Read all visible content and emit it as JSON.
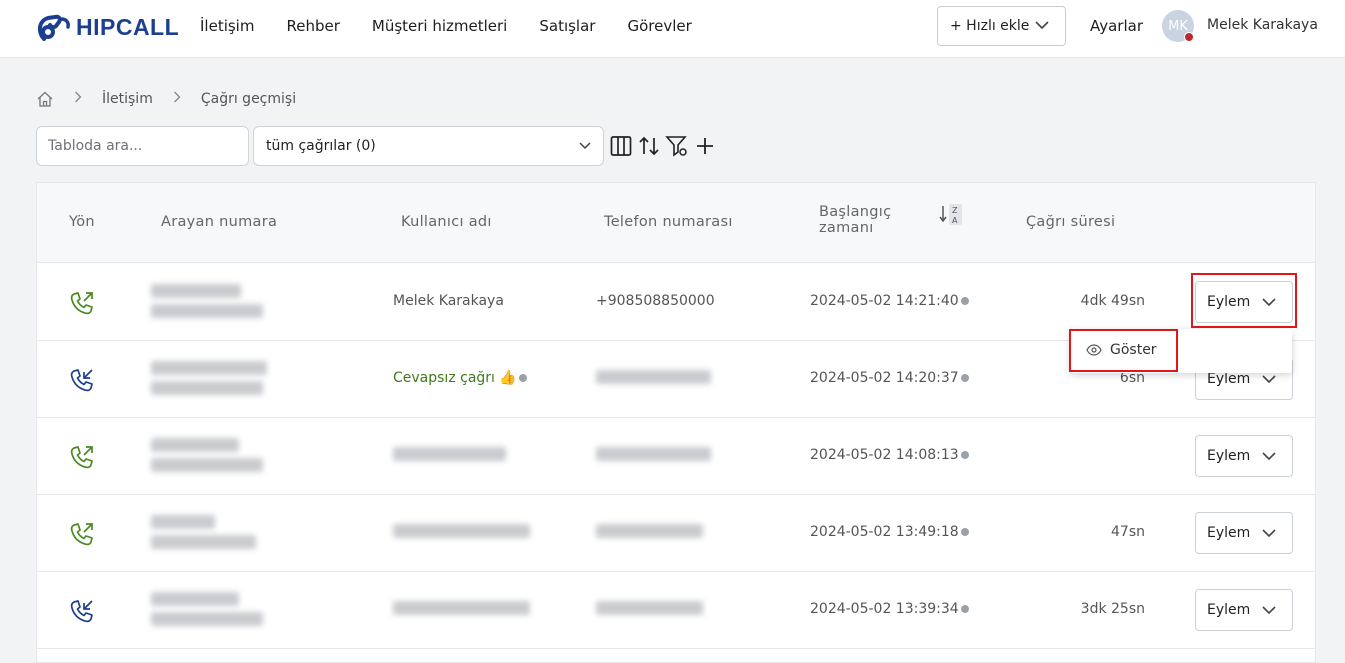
{
  "brand": {
    "name": "HIPCALL",
    "color": "#1d3f8f"
  },
  "nav": {
    "items": [
      "İletişim",
      "Rehber",
      "Müşteri hizmetleri",
      "Satışlar",
      "Görevler"
    ]
  },
  "header": {
    "quick_add": "+ Hızlı ekle",
    "settings": "Ayarlar",
    "avatar_initials": "MK",
    "username": "Melek Karakaya"
  },
  "breadcrumb": {
    "home_icon": "home-icon",
    "items": [
      "İletişim",
      "Çağrı geçmişi"
    ]
  },
  "toolbar": {
    "search_placeholder": "Tabloda ara...",
    "filter_value": "tüm çağrılar (0)",
    "icons": [
      "columns-icon",
      "sort-icon",
      "filter-settings-icon",
      "add-icon"
    ]
  },
  "table": {
    "columns": {
      "direction": "Yön",
      "caller": "Arayan numara",
      "user": "Kullanıcı adı",
      "phone": "Telefon numarası",
      "start_line1": "Başlangıç",
      "start_line2": "zamanı",
      "duration": "Çağrı süresi"
    },
    "rows": [
      {
        "direction": "outgoing",
        "user": "Melek Karakaya",
        "phone": "+908508850000",
        "start": "2024-05-02 14:21:40",
        "duration": "4dk 49sn",
        "action": "Eylem"
      },
      {
        "direction": "incoming",
        "user": "Cevapsız çağrı 👍",
        "phone": "",
        "start": "2024-05-02 14:20:37",
        "duration": "6sn",
        "action": "Eylem"
      },
      {
        "direction": "outgoing",
        "user": "",
        "phone": "",
        "start": "2024-05-02 14:08:13",
        "duration": "",
        "action": "Eylem"
      },
      {
        "direction": "outgoing",
        "user": "",
        "phone": "",
        "start": "2024-05-02 13:49:18",
        "duration": "47sn",
        "action": "Eylem"
      },
      {
        "direction": "incoming",
        "user": "",
        "phone": "",
        "start": "2024-05-02 13:39:34",
        "duration": "3dk 25sn",
        "action": "Eylem"
      }
    ]
  },
  "action_menu": {
    "items": [
      "Göster"
    ]
  },
  "colors": {
    "outgoing": "#4a8a22",
    "incoming": "#1d3f8f",
    "highlight": "#e0161b"
  }
}
